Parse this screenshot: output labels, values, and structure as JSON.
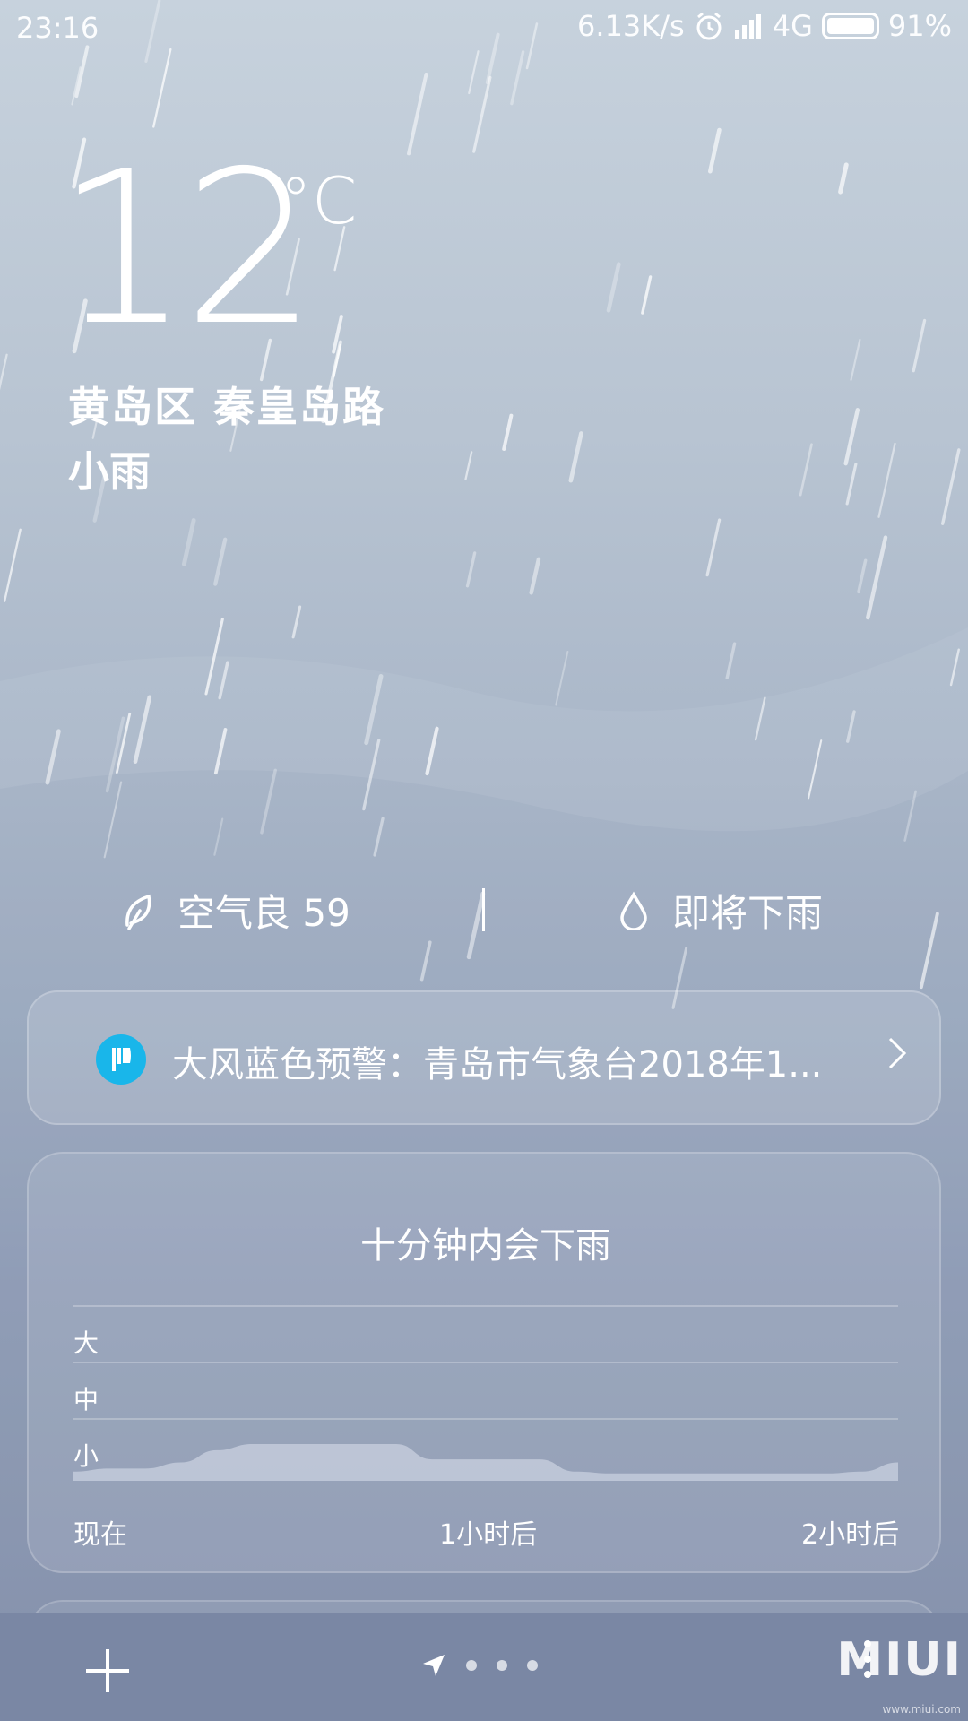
{
  "status_bar": {
    "time": "23:16",
    "net_speed": "6.13K/s",
    "network": "4G",
    "battery": "91%",
    "icons": [
      "alarm-icon",
      "signal-icon",
      "battery-icon"
    ]
  },
  "weather": {
    "temperature": "12",
    "unit": "°C",
    "location": "黄岛区  秦皇岛路",
    "condition": "小雨"
  },
  "info": {
    "air_quality": "空气良 59",
    "rain_hint": "即将下雨"
  },
  "alert": {
    "text": "大风蓝色预警：青岛市气象台2018年1..."
  },
  "forecast": {
    "title": "十分钟内会下雨",
    "levels": [
      "大",
      "中",
      "小"
    ],
    "x_labels": [
      "现在",
      "1小时后",
      "2小时后"
    ]
  },
  "chart_data": {
    "type": "area",
    "title": "十分钟内会下雨",
    "x_ticks": [
      "现在",
      "1小时后",
      "2小时后"
    ],
    "y_categories": [
      "小",
      "中",
      "大"
    ],
    "values": [
      0.15,
      0.2,
      0.2,
      0.3,
      0.5,
      0.6,
      0.6,
      0.6,
      0.6,
      0.6,
      0.35,
      0.35,
      0.35,
      0.35,
      0.15,
      0.12,
      0.12,
      0.12,
      0.12,
      0.12,
      0.12,
      0.12,
      0.15,
      0.3
    ],
    "grid": true
  },
  "bottom_bar": {
    "watermark": "MIUI",
    "watermark_sub": "www.miui.com"
  },
  "colors": {
    "alert_icon": "#19b6ea",
    "bottom_bar": "#7a87a4"
  }
}
